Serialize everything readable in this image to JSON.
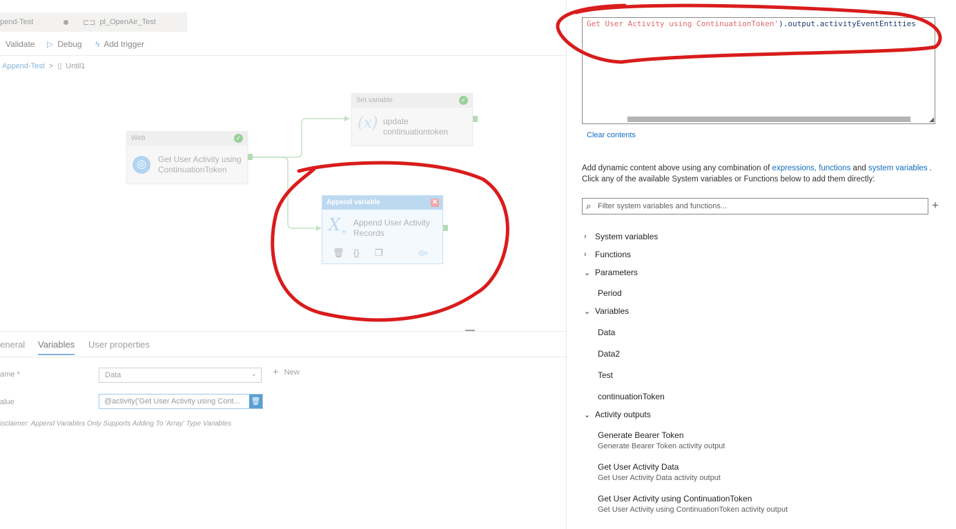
{
  "tabs": [
    {
      "label": "pend-Test"
    },
    {
      "label": "pl_OpenAir_Test"
    }
  ],
  "toolbar": {
    "validate": "Validate",
    "debug": "Debug",
    "add_trigger": "Add trigger"
  },
  "breadcrumb": {
    "pipeline": "Append-Test",
    "sep": ">",
    "activity": "Until1"
  },
  "activities": {
    "web": {
      "type": "Web",
      "name_line1": "Get User Activity using",
      "name_line2": "ContinuationToken"
    },
    "set": {
      "type": "Set variable",
      "name_line1": "update",
      "name_line2": "continuationtoken"
    },
    "append": {
      "type": "Append variable",
      "name_line1": "Append User Activity",
      "name_line2": "Records"
    }
  },
  "props": {
    "tabs": [
      {
        "label": "eneral"
      },
      {
        "label": "Variables"
      },
      {
        "label": "User properties"
      }
    ],
    "name_label": "ame *",
    "name_value": "Data",
    "new_label": "New",
    "value_label": "alue",
    "value_value": "@activity('Get User Activity using Cont...",
    "disclaimer": "isclaimer: Append Variables Only Supports Adding To 'Array' Type Variables"
  },
  "editor": {
    "code_string": "Get User Activity using ContinuationToken'",
    "code_rest": ").output.activityEventEntities",
    "clear_label": "Clear contents"
  },
  "help": {
    "text1": "Add dynamic content above using any combination of",
    "link1": "expressions, functions",
    "and": "and",
    "link2": "system variables",
    "dot": ".",
    "text2": "Click any of the available System variables or Functions below to add them directly:"
  },
  "filter": {
    "placeholder": "Filter system variables and functions..."
  },
  "tree": {
    "system_variables": "System variables",
    "functions": "Functions",
    "parameters": "Parameters",
    "params": [
      "Period"
    ],
    "variables": "Variables",
    "vars": [
      "Data",
      "Data2",
      "Test",
      "continuationToken"
    ],
    "activity_outputs": "Activity outputs",
    "outputs": [
      {
        "name": "Generate Bearer Token",
        "desc": "Generate Bearer Token activity output"
      },
      {
        "name": "Get User Activity Data",
        "desc": "Get User Activity Data activity output"
      },
      {
        "name": "Get User Activity using ContinuationToken",
        "desc": "Get User Activity using ContinuationToken activity output"
      }
    ]
  },
  "colors": {
    "accent": "#0f6cbd",
    "annotation": "#d91c1c",
    "success": "#9bd09b"
  }
}
